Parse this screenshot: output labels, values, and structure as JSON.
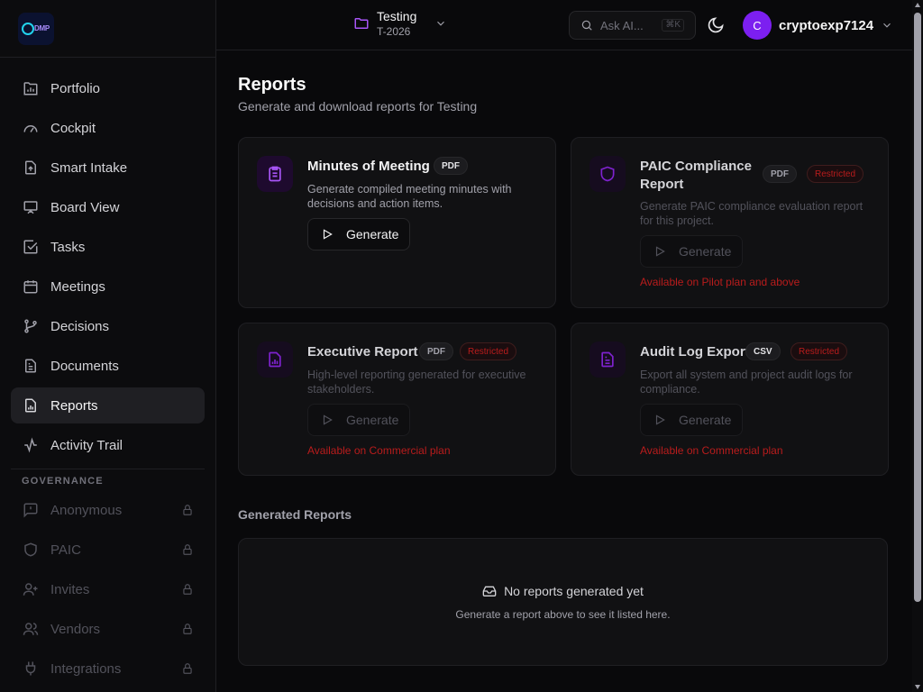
{
  "logo_text": "DMP",
  "sidebar": {
    "items": [
      {
        "label": "Portfolio"
      },
      {
        "label": "Cockpit"
      },
      {
        "label": "Smart Intake"
      },
      {
        "label": "Board View"
      },
      {
        "label": "Tasks"
      },
      {
        "label": "Meetings"
      },
      {
        "label": "Decisions"
      },
      {
        "label": "Documents"
      },
      {
        "label": "Reports"
      },
      {
        "label": "Activity Trail"
      }
    ],
    "section_label": "GOVERNANCE",
    "locked_items": [
      {
        "label": "Anonymous"
      },
      {
        "label": "PAIC"
      },
      {
        "label": "Invites"
      },
      {
        "label": "Vendors"
      },
      {
        "label": "Integrations"
      }
    ]
  },
  "header": {
    "project_name": "Testing",
    "project_code": "T-2026",
    "search_placeholder": "Ask AI...",
    "search_shortcut": "⌘K",
    "avatar_initial": "C",
    "username": "cryptoexp7124"
  },
  "main": {
    "title": "Reports",
    "subtitle": "Generate and download reports for Testing",
    "cards": [
      {
        "title": "Minutes of Meeting",
        "format": "PDF",
        "restricted": "",
        "description": "Generate compiled meeting minutes with decisions and action items.",
        "button": "Generate",
        "availability": ""
      },
      {
        "title": "PAIC Compliance Report",
        "format": "PDF",
        "restricted": "Restricted",
        "description": "Generate PAIC compliance evaluation report for this project.",
        "button": "Generate",
        "availability": "Available on Pilot plan and above"
      },
      {
        "title": "Executive Report",
        "format": "PDF",
        "restricted": "Restricted",
        "description": "High-level reporting generated for executive stakeholders.",
        "button": "Generate",
        "availability": "Available on Commercial plan"
      },
      {
        "title": "Audit Log Export",
        "format": "CSV",
        "restricted": "Restricted",
        "description": "Export all system and project audit logs for compliance.",
        "button": "Generate",
        "availability": "Available on Commercial plan"
      }
    ],
    "generated_title": "Generated Reports",
    "empty_title": "No reports generated yet",
    "empty_subtitle": "Generate a report above to see it listed here."
  },
  "colors": {
    "accent": "#7c1ff0",
    "restricted": "#b91c1c",
    "background": "#09090b"
  }
}
